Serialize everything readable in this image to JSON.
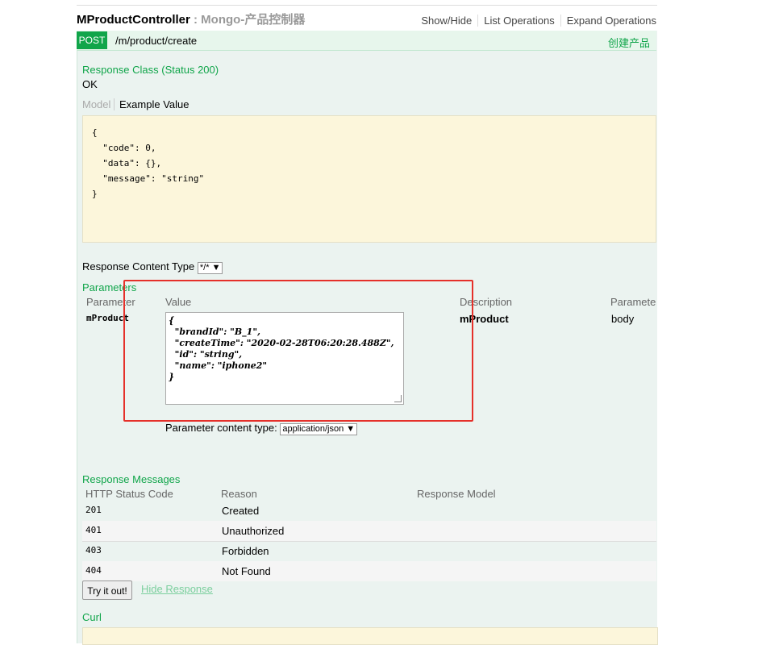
{
  "header": {
    "controller": "MProductController",
    "subtitle": " : Mongo-产品控制器",
    "links": [
      "Show/Hide",
      "List Operations",
      "Expand Operations"
    ]
  },
  "operation": {
    "method": "POST",
    "path": "/m/product/create",
    "summary": "创建产品"
  },
  "response_class": {
    "heading": "Response Class (Status 200)",
    "value": "OK",
    "tab_model": "Model",
    "tab_example": "Example Value",
    "example_json": "{\n  \"code\": 0,\n  \"data\": {},\n  \"message\": \"string\"\n}"
  },
  "response_content_type": {
    "label": "Response Content Type",
    "selected": "*/*"
  },
  "parameters": {
    "heading": "Parameters",
    "columns": [
      "Parameter",
      "Value",
      "Description",
      "Parameter"
    ],
    "rows": [
      {
        "name": "mProduct",
        "value": "{\n  \"brandId\": \"B_1\",\n  \"createTime\": \"2020-02-28T06:20:28.488Z\",\n  \"id\": \"string\",\n  \"name\": \"iphone2\"\n}",
        "description": "mProduct",
        "param_type": "body"
      }
    ],
    "content_type_label": "Parameter content type:",
    "content_type_selected": "application/json"
  },
  "response_messages": {
    "heading": "Response Messages",
    "columns": [
      "HTTP Status Code",
      "Reason",
      "Response Model"
    ],
    "rows": [
      {
        "code": "201",
        "reason": "Created"
      },
      {
        "code": "401",
        "reason": "Unauthorized"
      },
      {
        "code": "403",
        "reason": "Forbidden"
      },
      {
        "code": "404",
        "reason": "Not Found"
      }
    ]
  },
  "actions": {
    "try_label": "Try it out!",
    "hide_label": "Hide Response"
  },
  "curl": {
    "heading": "Curl"
  },
  "colors": {
    "post_green": "#10a54a",
    "panel_bg": "#ebf3f0",
    "highlight_red": "#e5302a",
    "code_bg": "#fcf6db"
  }
}
